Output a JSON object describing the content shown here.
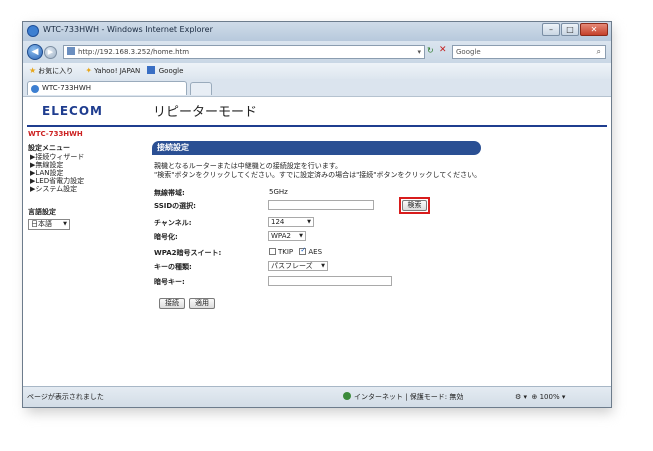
{
  "window": {
    "title": "WTC-733HWH - Windows Internet Explorer",
    "url": "http://192.168.3.252/home.htm",
    "search_placeholder": "Google",
    "min_symbol": "–",
    "max_symbol": "□",
    "close_symbol": "✕"
  },
  "favorites_bar": {
    "favorites": "お気に入り",
    "yahoo": "Yahoo! JAPAN",
    "google": "Google"
  },
  "tab": {
    "label": "WTC-733HWH"
  },
  "page": {
    "logo": "ELECOM",
    "title": "リピーターモード",
    "model": "WTC-733HWH",
    "menu_header": "設定メニュー",
    "menu_items": [
      "▶接続ウィザード",
      "▶無線設定",
      "▶LAN設定",
      "▶LED省電力設定",
      "▶システム設定"
    ],
    "language_header": "言語設定",
    "language_value": "日本語",
    "section_title": "接続設定",
    "desc_line1": "親機となるルーターまたは中継機との接続設定を行います。",
    "desc_line2": "\"検索\"ボタンをクリックしてください。すでに設定済みの場合は\"接続\"ボタンをクリックしてください。",
    "fields": {
      "band_label": "無線帯域:",
      "band_value": "5GHz",
      "ssid_label": "SSIDの選択:",
      "ssid_value": "",
      "search_button": "検索",
      "channel_label": "チャンネル:",
      "channel_value": "124",
      "encryption_label": "暗号化:",
      "encryption_value": "WPA2",
      "suite_label": "WPA2暗号スイート:",
      "tkip_label": "TKIP",
      "aes_label": "AES",
      "tkip_checked": false,
      "aes_checked": true,
      "keytype_label": "キーの種類:",
      "keytype_value": "パスフレーズ",
      "key_label": "暗号キー:",
      "key_value": ""
    },
    "connect_button": "接続",
    "apply_button": "適用"
  },
  "status": {
    "left": "ページが表示されました",
    "zone": "インターネット | 保護モード: 無効",
    "zoom": "100%"
  },
  "colors": {
    "brand": "#1f3d8f",
    "highlight": "#d81c1c",
    "model": "#cc2020"
  }
}
